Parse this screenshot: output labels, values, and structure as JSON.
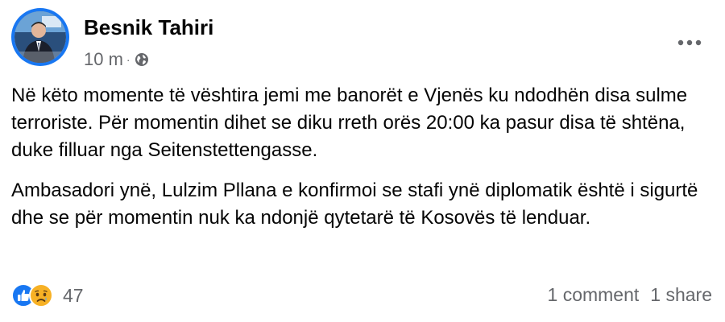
{
  "post": {
    "author": "Besnik Tahiri",
    "timestamp": "10 m",
    "meta_separator": "·",
    "visibility_icon": "globe-icon",
    "more_icon": "more-options-icon",
    "paragraphs": [
      "Në këto momente të vështira jemi me banorët e Vjenës ku ndodhën disa sulme terroriste. Për momentin dihet se diku rreth orës 20:00 ka pasur disa të shtëna, duke filluar nga Seitenstettengasse.",
      "Ambasadori ynë, Lulzim Pllana e konfirmoi se stafi ynë diplomatik është i sigurtë dhe se për momentin nuk ka ndonjë qytetarë të Kosovës të lenduar."
    ]
  },
  "footer": {
    "reaction_icons": [
      "like-icon",
      "sad-icon"
    ],
    "reaction_count": "47",
    "comments": "1 comment",
    "shares": "1 share"
  },
  "colors": {
    "text": "#050505",
    "secondary_text": "#65676b",
    "facebook_blue": "#1877f2",
    "sad_yellow": "#f7b125"
  }
}
